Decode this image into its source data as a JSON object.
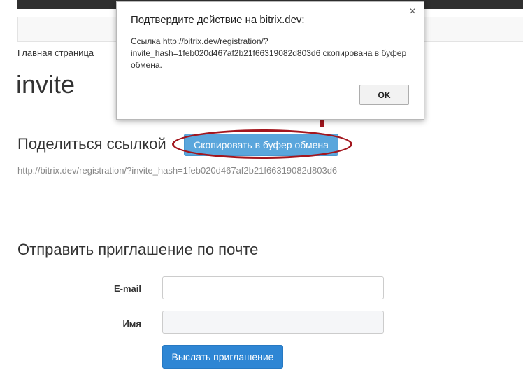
{
  "breadcrumb": "Главная страница",
  "page_title": "invite",
  "share": {
    "heading": "Поделиться ссылкой",
    "copy_button": "Скопировать в буфер обмена",
    "link": "http://bitrix.dev/registration/?invite_hash=1feb020d467af2b21f66319082d803d6"
  },
  "email_invite": {
    "heading": "Отправить приглашение по почте",
    "email_label": "E-mail",
    "email_value": "",
    "name_label": "Имя",
    "name_value": "",
    "submit_button": "Выслать приглашение"
  },
  "dialog": {
    "title": "Подтвердите действие на bitrix.dev:",
    "close_glyph": "×",
    "message": "Ссылка http://bitrix.dev/registration/?invite_hash=1feb020d467af2b21f66319082d803d6 скопирована в буфер обмена.",
    "ok_button": "OK"
  },
  "icons": {
    "close": "close-icon",
    "annotation_arrow": "arrow-up-icon"
  },
  "colors": {
    "primary_button": "#2e86d4",
    "copy_button": "#5aa6dc",
    "annotation": "#a3161e",
    "topbar": "#2f2f2f"
  }
}
